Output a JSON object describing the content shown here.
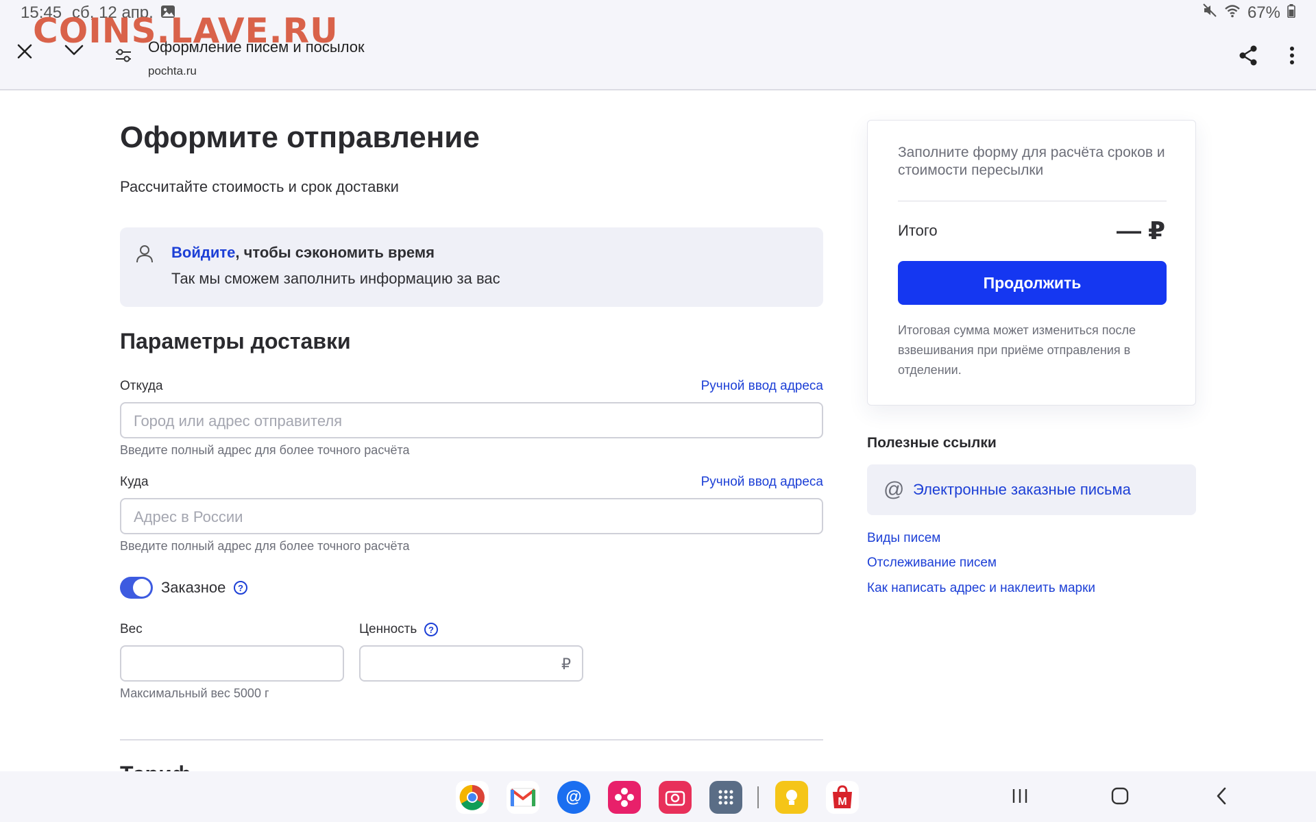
{
  "status": {
    "time": "15:45",
    "date": "сб, 12 апр.",
    "battery": "67%"
  },
  "watermark": "COINS.LAVE.RU",
  "browser": {
    "title": "Оформление писем и посылок",
    "url": "pochta.ru"
  },
  "page": {
    "title": "Оформите отправление",
    "subtitle": "Рассчитайте стоимость и срок доставки",
    "login": {
      "link": "Войдите",
      "rest": ", чтобы сэкономить время",
      "desc": "Так мы сможем заполнить информацию за вас"
    },
    "section_title": "Параметры доставки",
    "from": {
      "label": "Откуда",
      "manual": "Ручной ввод адреса",
      "placeholder": "Город или адрес отправителя",
      "hint": "Введите полный адрес для более точного расчёта"
    },
    "to": {
      "label": "Куда",
      "manual": "Ручной ввод адреса",
      "placeholder": "Адрес в России",
      "hint": "Введите полный адрес для более точного расчёта"
    },
    "registered": {
      "label": "Заказное",
      "checked": true
    },
    "weight": {
      "label": "Вес",
      "value": "",
      "hint": "Максимальный вес 5000 г"
    },
    "value_field": {
      "label": "Ценность",
      "value": "",
      "currency": "₽"
    },
    "next_section_partial": "Тариф"
  },
  "summary": {
    "info": "Заполните форму для расчёта сроков и стоимости пересылки",
    "total_label": "Итого",
    "total_value": "— ₽",
    "button": "Продолжить",
    "note": "Итоговая сумма может измениться после взвешивания при приёме отправления в отделении."
  },
  "useful_links": {
    "title": "Полезные ссылки",
    "highlight": "Электронные заказные письма",
    "items": [
      "Виды писем",
      "Отслеживание писем",
      "Как написать адрес и наклеить марки"
    ]
  },
  "colors": {
    "accent": "#1537f1",
    "link": "#1c3fd6",
    "panel": "#eff0f7"
  }
}
